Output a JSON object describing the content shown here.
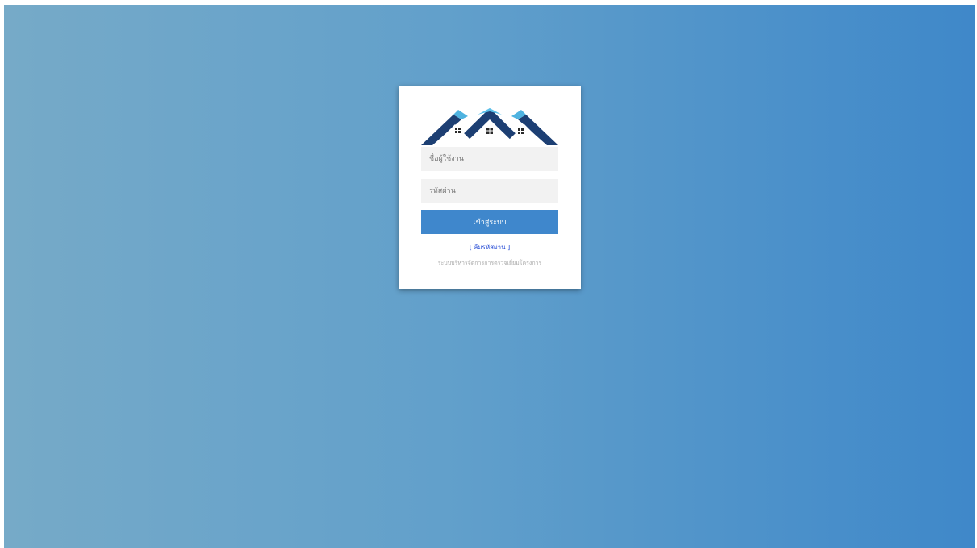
{
  "login": {
    "username_placeholder": "ชื่อผู้ใช้งาน",
    "password_placeholder": "รหัสผ่าน",
    "submit_label": "เข้าสู่ระบบ",
    "forgot_password_label": "[ ลืมรหัสผ่าน ]",
    "footer_text": "ระบบบริหารจัดการการตรวจเยี่ยมโครงการ"
  },
  "icons": {
    "logo": "houses-roof-logo-icon"
  },
  "colors": {
    "background_start": "#76aac8",
    "background_end": "#3f88c9",
    "button": "#3f87cc",
    "link": "#2a4fd6",
    "roof_dark": "#1d3f73",
    "roof_light": "#4fb3e0"
  }
}
